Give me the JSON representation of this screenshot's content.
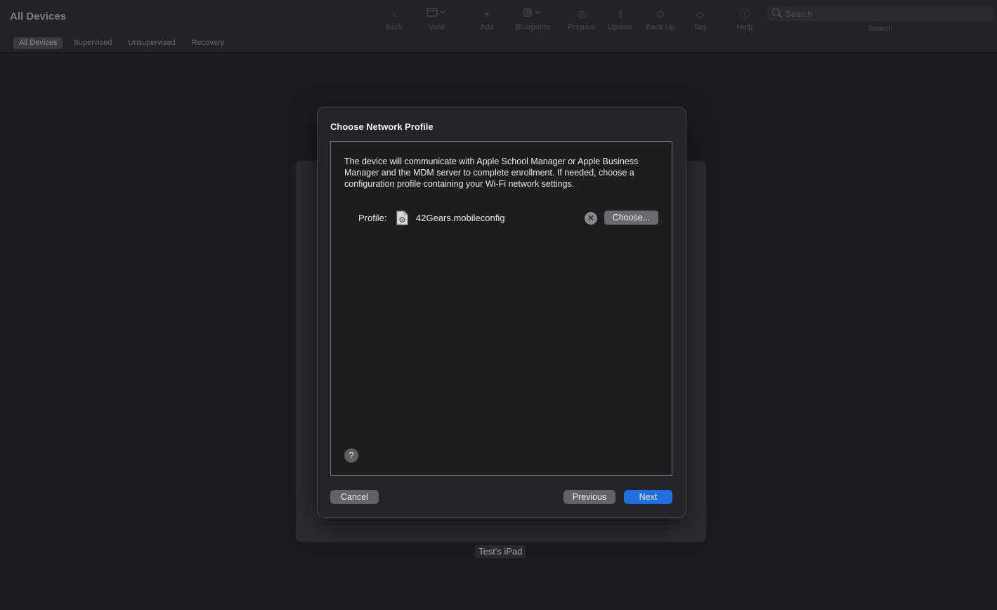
{
  "window": {
    "title": "All Devices"
  },
  "filters": {
    "items": [
      {
        "label": "All Devices"
      },
      {
        "label": "Supervised"
      },
      {
        "label": "Unsupervised"
      },
      {
        "label": "Recovery"
      }
    ]
  },
  "toolbar": {
    "back": {
      "label": "Back",
      "icon": "chevron-left-icon"
    },
    "view": {
      "label": "View",
      "icon": "window-icon"
    },
    "add": {
      "label": "Add",
      "icon": "plus-icon"
    },
    "blueprints": {
      "label": "Blueprints",
      "icon": "blueprint-icon"
    },
    "prepare": {
      "label": "Prepare",
      "icon": "prepare-icon"
    },
    "update": {
      "label": "Update",
      "icon": "update-icon"
    },
    "backup": {
      "label": "Back Up",
      "icon": "backup-icon"
    },
    "tag": {
      "label": "Tag",
      "icon": "tag-icon"
    },
    "help": {
      "label": "Help",
      "icon": "help-icon"
    }
  },
  "search": {
    "placeholder": "Search",
    "label": "Search"
  },
  "device": {
    "name": "Test's iPad"
  },
  "dialog": {
    "title": "Choose Network Profile",
    "description": "The device will communicate with Apple School Manager or Apple Business Manager and the MDM server to complete enrollment. If needed, choose a configuration profile containing your Wi-Fi network settings.",
    "profile_label": "Profile:",
    "profile_name": "42Gears.mobileconfig",
    "clear_glyph": "✕",
    "choose_label": "Choose...",
    "help_glyph": "?",
    "cancel_label": "Cancel",
    "previous_label": "Previous",
    "next_label": "Next"
  },
  "colors": {
    "accent": "#1f6fe0",
    "background": "#1c1b20",
    "sheet": "#252329"
  }
}
